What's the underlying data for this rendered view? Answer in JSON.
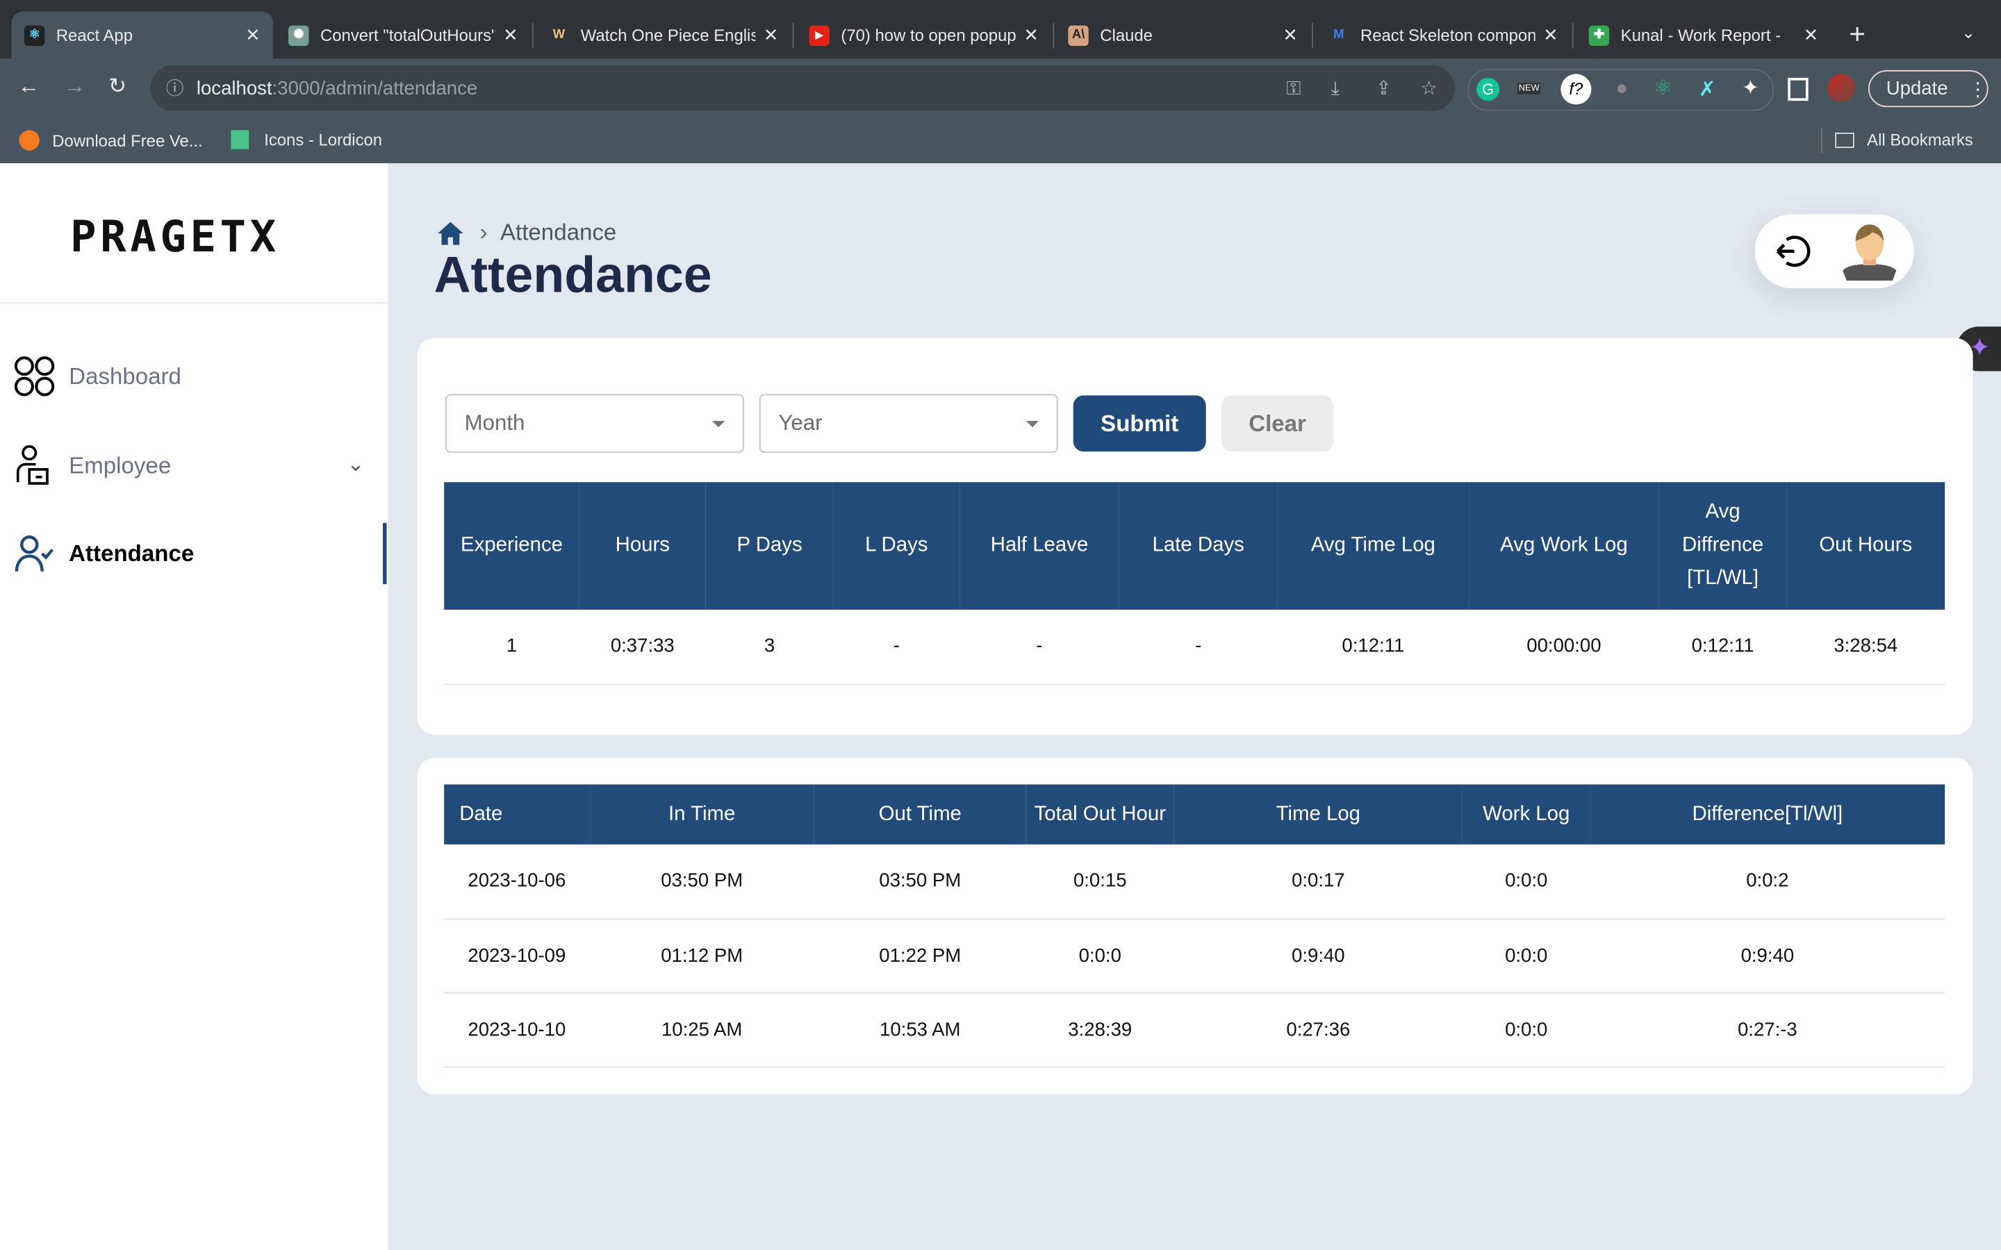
{
  "browser": {
    "tabs": [
      {
        "title": "React App",
        "active": true,
        "icon": "react-icon"
      },
      {
        "title": "Convert \"totalOutHours\"",
        "icon": "chatgpt-icon"
      },
      {
        "title": "Watch One Piece English",
        "icon": "w-logo-icon"
      },
      {
        "title": "(70) how to open popup",
        "icon": "youtube-icon"
      },
      {
        "title": "Claude",
        "icon": "anthropic-icon"
      },
      {
        "title": "React Skeleton component",
        "icon": "mui-icon"
      },
      {
        "title": "Kunal - Work Report -",
        "icon": "sheets-icon"
      }
    ],
    "url_host": "localhost",
    "url_path": ":3000/admin/attendance",
    "update_label": "Update",
    "bookmarks": [
      "Download Free Ve...",
      "Icons - Lordicon"
    ],
    "all_bookmarks": "All Bookmarks",
    "ext_new_badge": "NEW",
    "ext_f_label": "f?"
  },
  "sidebar": {
    "logo": "PRAGETX",
    "items": [
      {
        "label": "Dashboard",
        "icon": "dashboard-icon"
      },
      {
        "label": "Employee",
        "icon": "employee-icon"
      },
      {
        "label": "Attendance",
        "icon": "attendance-icon",
        "active": true
      }
    ]
  },
  "header": {
    "breadcrumb": "Attendance",
    "title": "Attendance"
  },
  "filters": {
    "month_placeholder": "Month",
    "year_placeholder": "Year",
    "submit": "Submit",
    "clear": "Clear"
  },
  "summary_table": {
    "headers": [
      "Experience",
      "Hours",
      "P Days",
      "L Days",
      "Half Leave",
      "Late Days",
      "Avg Time Log",
      "Avg Work Log",
      "Avg Diffrence [TL/WL]",
      "Out Hours"
    ],
    "header_diff_lines": [
      "Avg",
      "Diffrence",
      "[TL/WL]"
    ],
    "row": [
      "1",
      "0:37:33",
      "3",
      "-",
      "-",
      "-",
      "0:12:11",
      "00:00:00",
      "0:12:11",
      "3:28:54"
    ]
  },
  "detail_table": {
    "headers": [
      "Date",
      "In Time",
      "Out Time",
      "Total Out Hour",
      "Time Log",
      "Work Log",
      "Difference[Tl/Wl]"
    ],
    "rows": [
      [
        "2023-10-06",
        "03:50 PM",
        "03:50 PM",
        "0:0:15",
        "0:0:17",
        "0:0:0",
        "0:0:2"
      ],
      [
        "2023-10-09",
        "01:12 PM",
        "01:22 PM",
        "0:0:0",
        "0:9:40",
        "0:0:0",
        "0:9:40"
      ],
      [
        "2023-10-10",
        "10:25 AM",
        "10:53 AM",
        "3:28:39",
        "0:27:36",
        "0:0:0",
        "0:27:-3"
      ]
    ]
  },
  "colors": {
    "primary": "#224b7a",
    "title": "#1e2a4a",
    "background": "#e2e8f0"
  }
}
